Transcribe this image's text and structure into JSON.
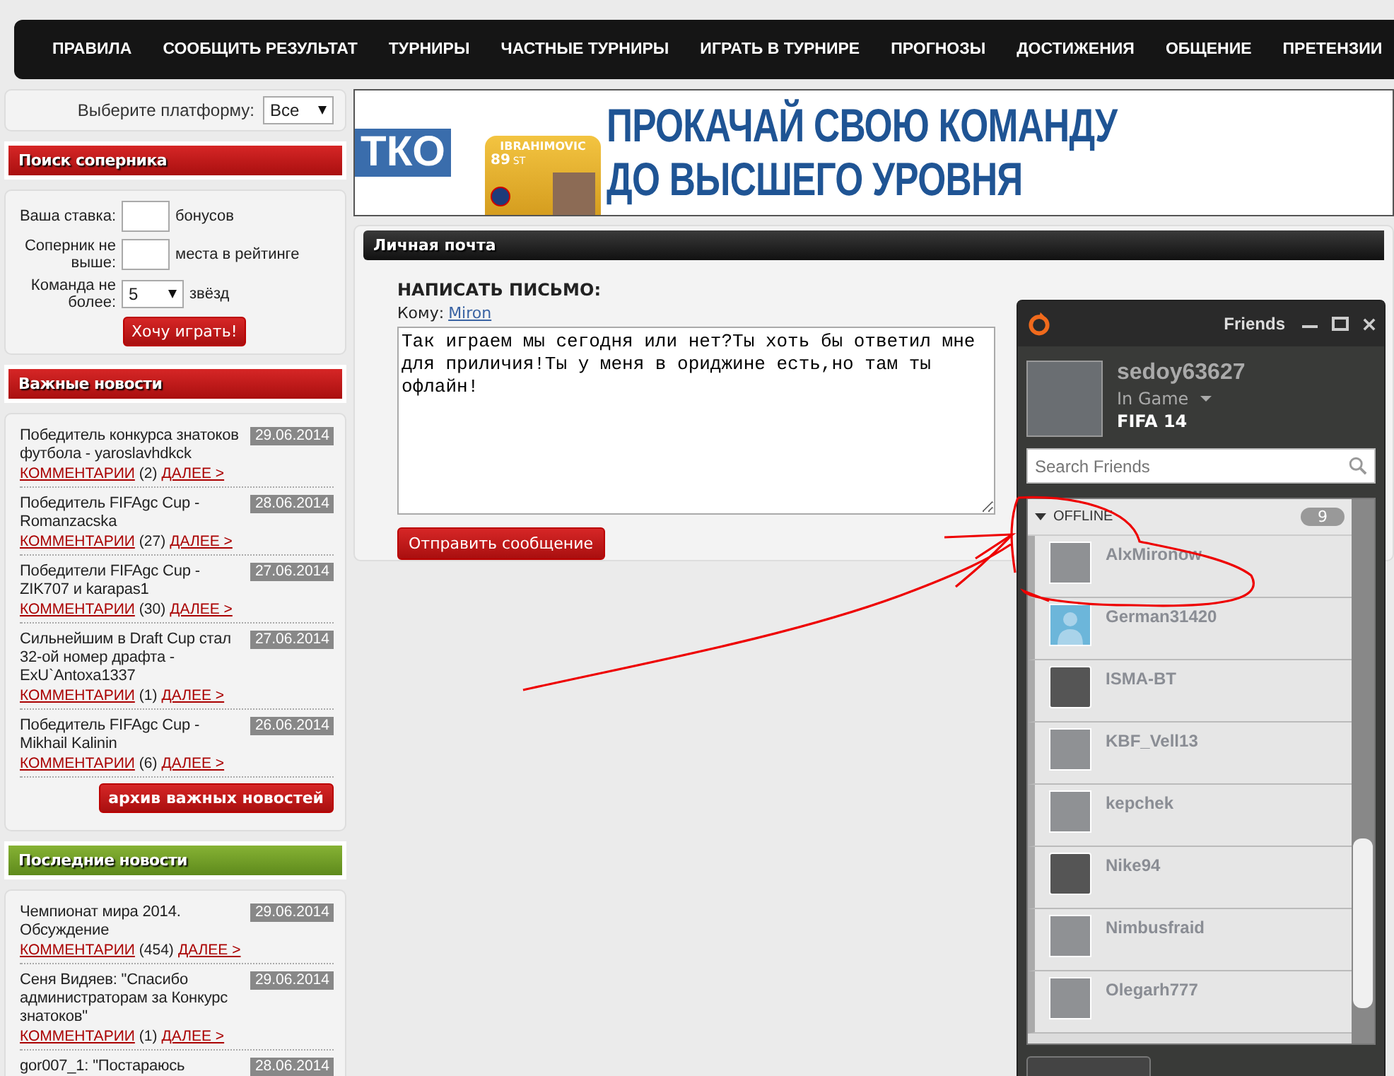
{
  "nav": [
    "ПРАВИЛА",
    "СООБЩИТЬ РЕЗУЛЬТАТ",
    "ТУРНИРЫ",
    "ЧАСТНЫЕ ТУРНИРЫ",
    "ИГРАТЬ В ТУРНИРЕ",
    "ПРОГНОЗЫ",
    "ДОСТИЖЕНИЯ",
    "ОБЩЕНИЕ",
    "ПРЕТЕНЗИИ"
  ],
  "platform": {
    "label": "Выберите платформу:",
    "value": "Все"
  },
  "opponent_search": {
    "title": "Поиск соперника",
    "fields": [
      {
        "label": "Ваша ставка:",
        "kind": "input",
        "suffix": "бонусов"
      },
      {
        "label": "Соперник не выше:",
        "kind": "input",
        "suffix": "места в рейтинге"
      },
      {
        "label": "Команда не более:",
        "kind": "select",
        "value": "5",
        "suffix": "звёзд"
      }
    ],
    "button": "Хочу играть!"
  },
  "important_news": {
    "title": "Важные новости",
    "items": [
      {
        "text": "Победитель конкурса знатоков футбола - yaroslavhdkck",
        "date": "29.06.2014",
        "comments": "КОММЕНТАРИИ",
        "count": "(2)",
        "more": "ДАЛЕЕ >"
      },
      {
        "text": "Победитель FIFAgc Cup - Romanzacska",
        "date": "28.06.2014",
        "comments": "КОММЕНТАРИИ",
        "count": "(27)",
        "more": "ДАЛЕЕ >"
      },
      {
        "text": "Победители FIFAgc Cup - ZIK707 и karapas1",
        "date": "27.06.2014",
        "comments": "КОММЕНТАРИИ",
        "count": "(30)",
        "more": "ДАЛЕЕ >"
      },
      {
        "text": "Сильнейшим в Draft Cup стал 32-ой номер драфта - ExU`Antoxa1337",
        "date": "27.06.2014",
        "comments": "КОММЕНТАРИИ",
        "count": "(1)",
        "more": "ДАЛЕЕ >"
      },
      {
        "text": "Победитель FIFAgc Cup - Mikhail Kalinin",
        "date": "26.06.2014",
        "comments": "КОММЕНТАРИИ",
        "count": "(6)",
        "more": "ДАЛЕЕ >"
      }
    ],
    "archive_button": "архив важных новостей"
  },
  "latest_news": {
    "title": "Последние новости",
    "items": [
      {
        "text": "Чемпионат мира 2014. Обсуждение",
        "date": "29.06.2014",
        "comments": "КОММЕНТАРИИ",
        "count": "(454)",
        "more": "ДАЛЕЕ >"
      },
      {
        "text": "Сеня Видяев: \"Спасибо администраторам за Конкурс знатоков\"",
        "date": "29.06.2014",
        "comments": "КОММЕНТАРИИ",
        "count": "(1)",
        "more": "ДАЛЕЕ >"
      },
      {
        "text": "gor007_1: \"Постараюсь",
        "date": "28.06.2014"
      }
    ]
  },
  "banner": {
    "logo": "ТКО",
    "card_name": "IBRAHIMOVIC",
    "card_rating": "89",
    "card_position": "ST",
    "headline_1": "ПРОКАЧАЙ СВОЮ КОМАНДУ",
    "headline_2": "ДО ВЫСШЕГО УРОВНЯ"
  },
  "mail": {
    "title": "Личная почта",
    "heading": "НАПИСАТЬ ПИСЬМО:",
    "to_label": "Кому:",
    "to": "Miron",
    "message": "Так играем мы сегодня или нет?Ты хоть бы ответил мне для приличия!Ты у меня в ориджине есть,но там ты офлайн!",
    "send_button": "Отправить сообщение"
  },
  "friends_window": {
    "title": "Friends",
    "user": {
      "name": "sedoy63627",
      "status": "In Game",
      "game": "FIFA 14"
    },
    "search": {
      "placeholder": "Search Friends"
    },
    "group": {
      "name": "OFFLINE",
      "count": "9",
      "expanded": true
    },
    "friends": [
      {
        "name": "AlxMironow",
        "kind": "photo"
      },
      {
        "name": "German31420",
        "kind": "default"
      },
      {
        "name": "ISMA-BT",
        "kind": "emblem"
      },
      {
        "name": "KBF_Vell13",
        "kind": "photo"
      },
      {
        "name": "kepchek",
        "kind": "photo"
      },
      {
        "name": "Nike94",
        "kind": "emblem"
      },
      {
        "name": "Nimbusfraid",
        "kind": "photo"
      },
      {
        "name": "Olegarh777",
        "kind": "photo"
      }
    ]
  }
}
